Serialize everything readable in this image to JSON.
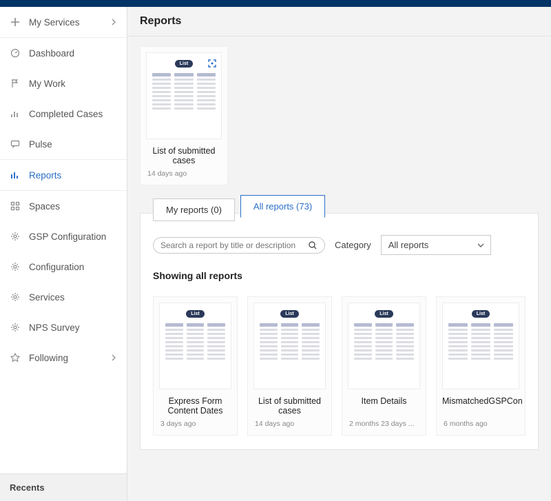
{
  "header": {
    "title": "Reports"
  },
  "sidebar": {
    "items": [
      {
        "label": "My Services",
        "has_chevron": true
      },
      {
        "label": "Dashboard"
      },
      {
        "label": "My Work"
      },
      {
        "label": "Completed Cases"
      },
      {
        "label": "Pulse"
      },
      {
        "label": "Reports",
        "active": true
      },
      {
        "label": "Spaces"
      },
      {
        "label": "GSP Configuration"
      },
      {
        "label": "Configuration"
      },
      {
        "label": "Services"
      },
      {
        "label": "NPS Survey"
      },
      {
        "label": "Following",
        "has_chevron": true
      }
    ],
    "recents_label": "Recents"
  },
  "pinned_report": {
    "badge": "List",
    "title": "List of submitted cases",
    "meta": "14 days ago"
  },
  "tabs": {
    "my_reports": "My reports (0)",
    "all_reports": "All reports (73)"
  },
  "search": {
    "placeholder": "Search a report by title or description"
  },
  "category": {
    "label": "Category",
    "selected": "All reports"
  },
  "showing_label": "Showing all reports",
  "reports": [
    {
      "badge": "List",
      "title": "Express Form Content Dates",
      "meta": "3 days ago"
    },
    {
      "badge": "List",
      "title": "List of submitted cases",
      "meta": "14 days ago"
    },
    {
      "badge": "List",
      "title": "Item Details",
      "meta": "2 months 23 days ..."
    },
    {
      "badge": "List",
      "title": "MismatchedGSPCon",
      "meta": "6 months ago"
    }
  ]
}
